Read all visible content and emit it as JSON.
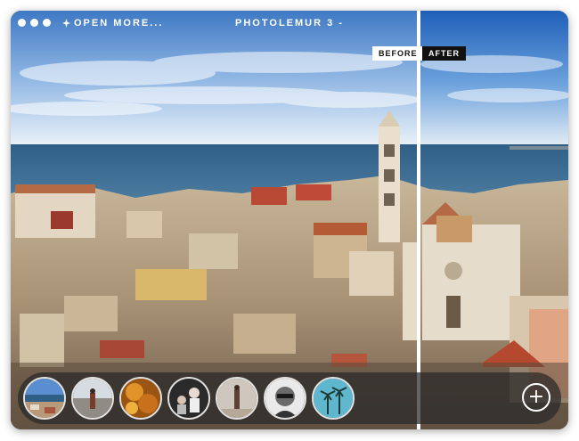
{
  "window": {
    "open_more_label": "OPEN MORE...",
    "app_title": "PHOTOLEMUR 3",
    "title_chevron": "-"
  },
  "compare": {
    "before_label": "BEFORE",
    "after_label": "AFTER"
  },
  "filmstrip": {
    "thumbnails": [
      {
        "name": "aerial-city"
      },
      {
        "name": "person-beach"
      },
      {
        "name": "autumn-leaves"
      },
      {
        "name": "group-portrait"
      },
      {
        "name": "woman-walking"
      },
      {
        "name": "bw-portrait"
      },
      {
        "name": "palm-trees"
      }
    ],
    "add_icon": "plus-icon",
    "add_symbol": "+"
  }
}
